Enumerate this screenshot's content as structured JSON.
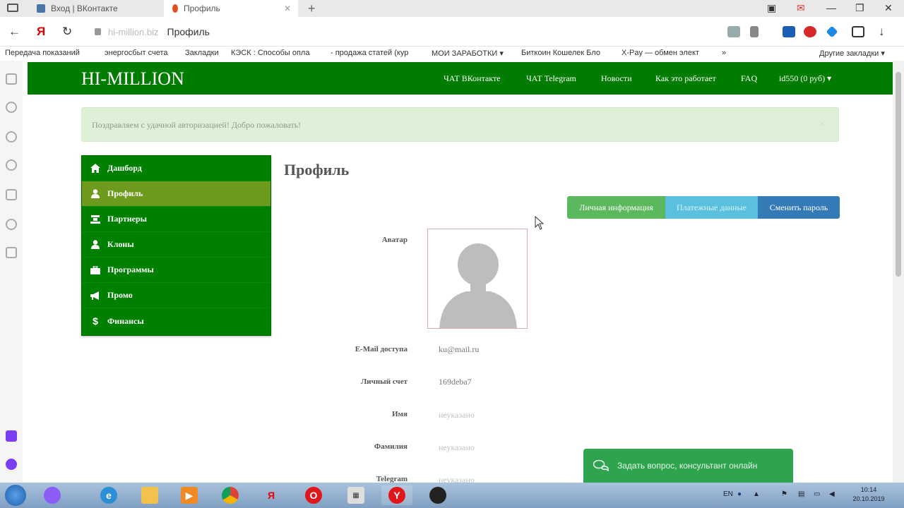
{
  "browser": {
    "tabs": [
      {
        "label": "Вход | ВКонтакте",
        "active": false,
        "favicon_color": "#4a76a8"
      },
      {
        "label": "Профиль",
        "active": true,
        "favicon_color": "#e34f26"
      }
    ],
    "new_tab": "+",
    "url_domain": "hi-million.biz",
    "url_title": "Профиль",
    "bookmarks": [
      "Передача показаний",
      "энергосбыт счета",
      "Закладки",
      "КЭСК : Способы опла",
      "- продажа статей (кур",
      "МОИ ЗАРАБОТКИ ▾",
      "Биткоин Кошелек Бло",
      "X-Pay — обмен элект",
      "»",
      "Другие закладки ▾"
    ]
  },
  "site": {
    "brand": "HI-MILLION",
    "nav": [
      "ЧАТ ВКонтакте",
      "ЧАТ Telegram",
      "Новости",
      "Как это работает",
      "FAQ",
      "id550 (0 руб) ▾"
    ],
    "alert": "Поздравляем с удачной авторизацией! Добро пожаловать!",
    "alert_close": "×",
    "menu": [
      {
        "label": "Дашборд",
        "icon": "home-icon",
        "active": false
      },
      {
        "label": "Профиль",
        "icon": "user-icon",
        "active": true
      },
      {
        "label": "Партнеры",
        "icon": "partners-icon",
        "active": false
      },
      {
        "label": "Клоны",
        "icon": "user-icon",
        "active": false
      },
      {
        "label": "Программы",
        "icon": "briefcase-icon",
        "active": false
      },
      {
        "label": "Промо",
        "icon": "megaphone-icon",
        "active": false
      },
      {
        "label": "Финансы",
        "icon": "dollar-icon",
        "active": false
      }
    ],
    "page_title": "Профиль",
    "buttons": {
      "personal_info": "Личная информация",
      "payment_data": "Платежные данные",
      "change_password": "Сменить пароль"
    },
    "fields": [
      {
        "label": "Аватар",
        "value": ""
      },
      {
        "label": "E-Mail доступа",
        "value": "ku@mail.ru"
      },
      {
        "label": "Личный счет",
        "value": "169deba7"
      },
      {
        "label": "Имя",
        "value": "неуказано"
      },
      {
        "label": "Фамилия",
        "value": "неуказано"
      },
      {
        "label": "Telegram",
        "value": "неуказано"
      }
    ],
    "chat_widget": "Задать вопрос, консультант онлайн"
  },
  "taskbar": {
    "items": [
      "start-orb",
      "alice",
      "ie",
      "explorer",
      "media",
      "chrome",
      "yandex",
      "opera",
      "calculator",
      "yandex-browser",
      "obs"
    ],
    "lang": "EN",
    "time": "10:14",
    "date": "20.10.2019"
  },
  "colors": {
    "site_green": "#007c00",
    "menu_active": "#6e9b1e",
    "btn_green": "#5cb85c",
    "btn_cyan": "#5bc0de",
    "btn_blue": "#337ab7",
    "chat_green": "#2ea44f"
  }
}
